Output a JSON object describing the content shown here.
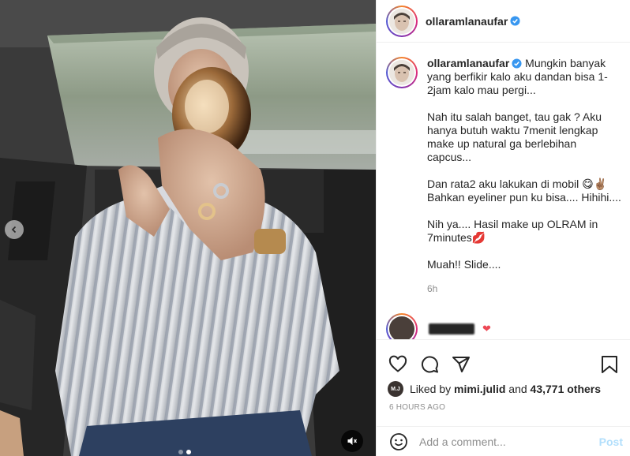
{
  "post": {
    "username": "ollaramlanaufar",
    "verified": true,
    "caption": {
      "line1": "Mungkin banyak yang berfikir kalo aku dandan bisa 1-2jam kalo mau pergi...",
      "para2": "Nah itu salah banget, tau gak ? Aku hanya butuh waktu 7menit lengkap make up natural ga berlebihan capcus...",
      "para3": "Dan rata2 aku lakukan di mobil 😋✌🏽 Bahkan eyeliner pun ku bisa.... Hihihi....",
      "para4": "Nih ya.... Hasil make up OLRAM in 7minutes💋",
      "para5": "Muah!! Slide...."
    },
    "caption_time": "6h",
    "likes": {
      "prefix": "Liked by",
      "liker": "mimi.julid",
      "connector": "and",
      "count": "43,771 others",
      "liker_avatar_text": "M.J"
    },
    "posted_ago": "6 HOURS AGO"
  },
  "comment_box": {
    "placeholder": "Add a comment...",
    "post_label": "Post"
  },
  "carousel": {
    "slides": 2,
    "active": 1
  },
  "colors": {
    "verified": "#3897f0",
    "heart": "#ed4956",
    "post_disabled": "#b2dffc",
    "muted_text": "#8e8e8e"
  },
  "icons": [
    "heart-icon",
    "comment-icon",
    "share-icon",
    "bookmark-icon",
    "emoji-icon",
    "mute-icon",
    "chevron-left-icon",
    "verified-icon"
  ]
}
